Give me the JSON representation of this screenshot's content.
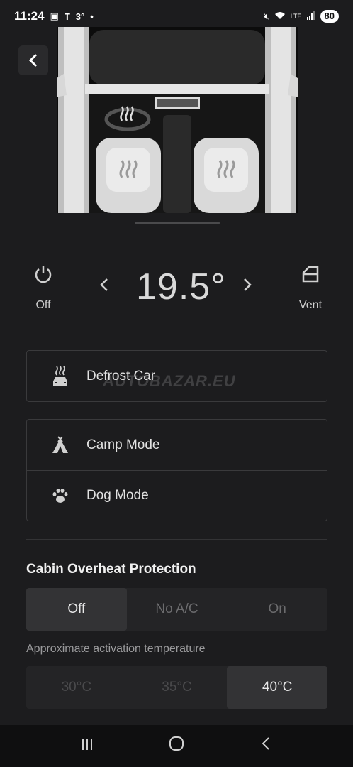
{
  "status_bar": {
    "time": "11:24",
    "temperature": "3°",
    "battery": "80",
    "lte_label": "LTE"
  },
  "climate": {
    "power_label": "Off",
    "temperature": "19.5°",
    "vent_label": "Vent"
  },
  "options": [
    {
      "label": "Defrost Car",
      "icon": "defrost-car-icon"
    }
  ],
  "modes": [
    {
      "label": "Camp Mode",
      "icon": "tent-icon"
    },
    {
      "label": "Dog Mode",
      "icon": "paw-icon"
    }
  ],
  "watermark": "AUTOBAZAR.EU",
  "overheat": {
    "title": "Cabin Overheat Protection",
    "options": [
      "Off",
      "No A/C",
      "On"
    ],
    "selected": "Off",
    "activation_label": "Approximate activation temperature",
    "temperatures": [
      "30°C",
      "35°C",
      "40°C"
    ],
    "selected_temperature": "40°C"
  }
}
